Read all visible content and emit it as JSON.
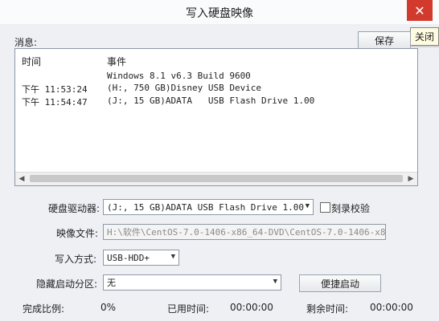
{
  "window": {
    "title": "写入硬盘映像",
    "close_icon": "✕",
    "tooltip": "关闭"
  },
  "messages": {
    "label": "消息:",
    "save_label": "保存",
    "columns": {
      "time": "时间",
      "event": "事件"
    },
    "rows": [
      {
        "time": "",
        "event": "Windows 8.1 v6.3 Build 9600"
      },
      {
        "time": "下午 11:53:24",
        "event": "(H:, 750 GB)Disney USB Device"
      },
      {
        "time": "下午 11:54:47",
        "event": "(J:, 15 GB)ADATA   USB Flash Drive 1.00"
      }
    ]
  },
  "form": {
    "drive_label": "硬盘驱动器:",
    "drive_value": "(J:, 15 GB)ADATA   USB Flash Drive 1.00",
    "verify_label": "刻录校验",
    "image_label": "映像文件:",
    "image_value": "H:\\软件\\CentOS-7.0-1406-x86_64-DVD\\CentOS-7.0-1406-x86_64-D",
    "mode_label": "写入方式:",
    "mode_value": "USB-HDD+",
    "hidden_label": "隐藏启动分区:",
    "hidden_value": "无",
    "portable_label": "便捷启动"
  },
  "status": {
    "ratio_label": "完成比例:",
    "ratio_value": "0%",
    "elapsed_label": "已用时间:",
    "elapsed_value": "00:00:00",
    "remaining_label": "剩余时间:",
    "remaining_value": "00:00:00"
  }
}
